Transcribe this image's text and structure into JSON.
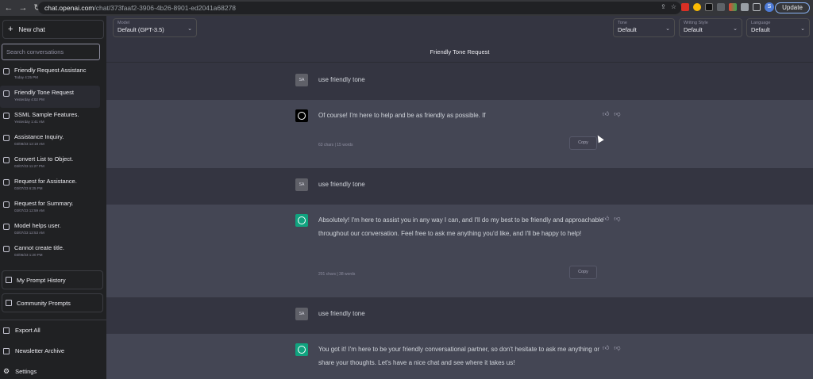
{
  "browser": {
    "url_host": "chat.openai.com",
    "url_path": "/chat/373faaf2-3906-4b26-8901-ed2041a68278",
    "update_label": "Update",
    "profile_initial": "S"
  },
  "sidebar": {
    "new_chat": "New chat",
    "search_placeholder": "Search conversations",
    "conversations": [
      {
        "title": "Friendly Request Assistanc",
        "date": "Today 4:25 PM"
      },
      {
        "title": "Friendly Tone Request",
        "date": "Yesterday 4:02 PM"
      },
      {
        "title": "SSML Sample Features.",
        "date": "Yesterday 1:41 AM"
      },
      {
        "title": "Assistance Inquiry.",
        "date": "03/08/23 12:18 AM"
      },
      {
        "title": "Convert List to Object.",
        "date": "03/07/23 11:27 PM"
      },
      {
        "title": "Request for Assistance.",
        "date": "03/07/23 6:25 PM"
      },
      {
        "title": "Request for Summary.",
        "date": "03/07/23 12:59 AM"
      },
      {
        "title": "Model helps user.",
        "date": "03/07/23 12:53 AM"
      },
      {
        "title": "Cannot create title.",
        "date": "03/06/23 1:20 PM"
      }
    ],
    "prompt_history": "My Prompt History",
    "community_prompts": "Community Prompts",
    "export_all": "Export All",
    "newsletter": "Newsletter Archive",
    "settings": "Settings"
  },
  "toolbar": {
    "model": {
      "label": "Model",
      "value": "Default (GPT-3.5)"
    },
    "tone": {
      "label": "Tone",
      "value": "Default"
    },
    "writing_style": {
      "label": "Writing Style",
      "value": "Default"
    },
    "language": {
      "label": "Language",
      "value": "Default"
    }
  },
  "chat": {
    "title": "Friendly Tone Request",
    "messages": [
      {
        "role": "user",
        "avatar": "SA",
        "text": "use friendly tone"
      },
      {
        "role": "assistant",
        "text": "Of course! I'm here to help and be as friendly as possible. If",
        "meta": "63 chars | 15 words",
        "copy": "Copy"
      },
      {
        "role": "user",
        "avatar": "SA",
        "text": "use friendly tone"
      },
      {
        "role": "assistant",
        "text": "Absolutely! I'm here to assist you in any way I can, and I'll do my best to be friendly and approachable throughout our conversation. Feel free to ask me anything you'd like, and I'll be happy to help!",
        "meta": "201 chars | 38 words",
        "copy": "Copy"
      },
      {
        "role": "user",
        "avatar": "SA",
        "text": "use friendly tone"
      },
      {
        "role": "assistant",
        "text": "You got it! I'm here to be your friendly conversational partner, so don't hesitate to ask me anything or share your thoughts. Let's have a nice chat and see where it takes us!"
      }
    ]
  }
}
